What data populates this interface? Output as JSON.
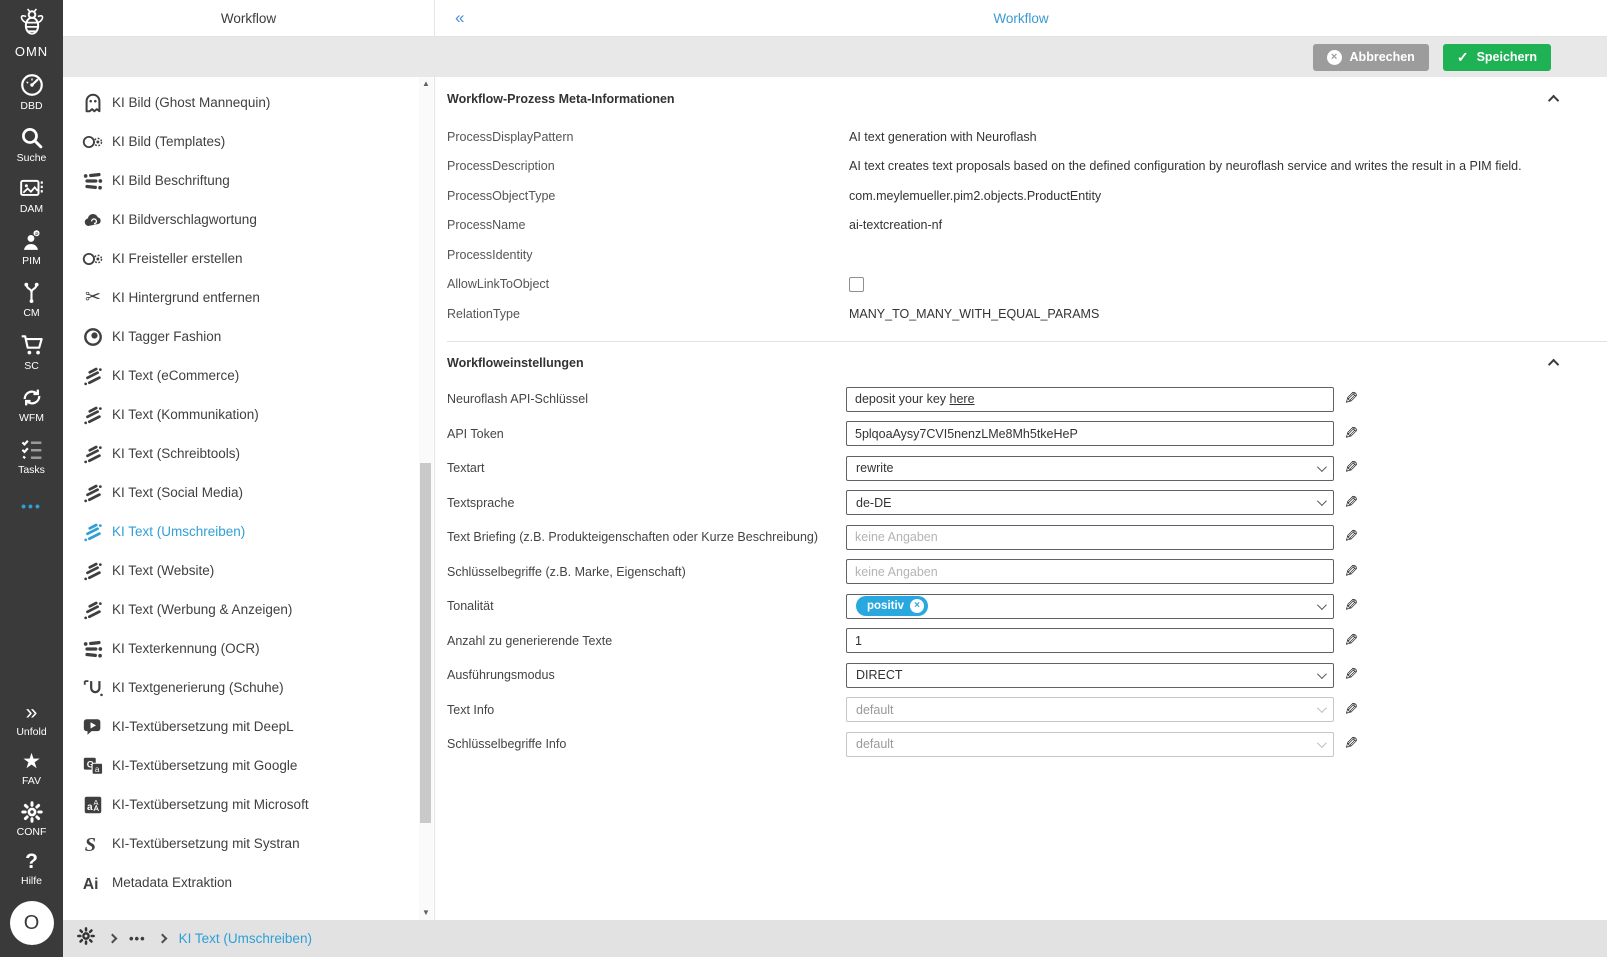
{
  "glyphs": {
    "pencil": "✎",
    "check": "✓",
    "close": "×",
    "collapse_left": "«",
    "scroll_up": "▲",
    "scroll_down": "▼",
    "chevron_double_right": "»",
    "star": "★",
    "question": "?",
    "dots": "•••",
    "scissors": "✂"
  },
  "colors": {
    "accent_blue": "#2f9fd6",
    "tag_blue": "#29a8df",
    "save_green": "#1fb254",
    "cancel_gray": "#9c9c9c",
    "sidebar_dark": "#3a3a3a"
  },
  "left_nav": {
    "logo_label": "OMN",
    "items": [
      {
        "label": "DBD"
      },
      {
        "label": "Suche"
      },
      {
        "label": "DAM"
      },
      {
        "label": "PIM"
      },
      {
        "label": "CM"
      },
      {
        "label": "SC"
      },
      {
        "label": "WFM"
      },
      {
        "label": "Tasks"
      }
    ],
    "bottom": [
      {
        "label": "Unfold"
      },
      {
        "label": "FAV"
      },
      {
        "label": "CONF"
      },
      {
        "label": "Hilfe"
      }
    ],
    "avatar": "O"
  },
  "list_panel": {
    "title": "Workflow",
    "items": [
      {
        "label": "KI Bild (Ghost Mannequin)"
      },
      {
        "label": "KI Bild (Templates)"
      },
      {
        "label": "KI Bild Beschriftung"
      },
      {
        "label": "KI Bildverschlagwortung"
      },
      {
        "label": "KI Freisteller erstellen"
      },
      {
        "label": "KI Hintergrund entfernen"
      },
      {
        "label": "KI Tagger Fashion"
      },
      {
        "label": "KI Text (eCommerce)"
      },
      {
        "label": "KI Text (Kommunikation)"
      },
      {
        "label": "KI Text (Schreibtools)"
      },
      {
        "label": "KI Text (Social Media)"
      },
      {
        "label": "KI Text (Umschreiben)",
        "selected": true
      },
      {
        "label": "KI Text (Website)"
      },
      {
        "label": "KI Text (Werbung & Anzeigen)"
      },
      {
        "label": "KI Texterkennung (OCR)"
      },
      {
        "label": "KI Textgenerierung (Schuhe)"
      },
      {
        "label": "KI-Textübersetzung mit DeepL"
      },
      {
        "label": "KI-Textübersetzung mit Google"
      },
      {
        "label": "KI-Textübersetzung mit Microsoft"
      },
      {
        "label": "KI-Textübersetzung mit Systran"
      },
      {
        "label": "Metadata Extraktion"
      }
    ]
  },
  "footer": {
    "ellipsis": "•••",
    "current": "KI Text (Umschreiben)"
  },
  "main": {
    "title": "Workflow",
    "toolbar": {
      "cancel": "Abbrechen",
      "save": "Speichern"
    },
    "meta": {
      "title": "Workflow-Prozess Meta-Informationen",
      "rows": [
        {
          "label": "ProcessDisplayPattern",
          "value": "AI text generation with Neuroflash"
        },
        {
          "label": "ProcessDescription",
          "value": "AI text creates text proposals based on the defined configuration by neuroflash service and writes the result in a PIM field."
        },
        {
          "label": "ProcessObjectType",
          "value": "com.meylemueller.pim2.objects.ProductEntity"
        },
        {
          "label": "ProcessName",
          "value": "ai-textcreation-nf"
        },
        {
          "label": "ProcessIdentity",
          "value": ""
        },
        {
          "label": "AllowLinkToObject",
          "checked": false
        },
        {
          "label": "RelationType",
          "value": "MANY_TO_MANY_WITH_EQUAL_PARAMS"
        }
      ]
    },
    "settings": {
      "title": "Workfloweinstellungen",
      "fields": [
        {
          "label": "Neuroflash API-Schlüssel",
          "value_prefix": "deposit your key ",
          "link_text": "here"
        },
        {
          "label": "API Token",
          "value": "5plqoaAysy7CVI5nenzLMe8Mh5tkeHeP"
        },
        {
          "label": "Textart",
          "value": "rewrite"
        },
        {
          "label": "Textsprache",
          "value": "de-DE"
        },
        {
          "label": "Text Briefing (z.B. Produkteigenschaften oder Kurze Beschreibung)",
          "value": "",
          "placeholder": "keine Angaben"
        },
        {
          "label": "Schlüsselbegriffe (z.B. Marke, Eigenschaft)",
          "value": "",
          "placeholder": "keine Angaben"
        },
        {
          "label": "Tonalität",
          "tag": "positiv"
        },
        {
          "label": "Anzahl zu generierende Texte",
          "value": "1"
        },
        {
          "label": "Ausführungsmodus",
          "value": "DIRECT"
        },
        {
          "label": "Text Info",
          "value": "default",
          "disabled": true
        },
        {
          "label": "Schlüsselbegriffe Info",
          "value": "default",
          "disabled": true
        }
      ]
    }
  }
}
